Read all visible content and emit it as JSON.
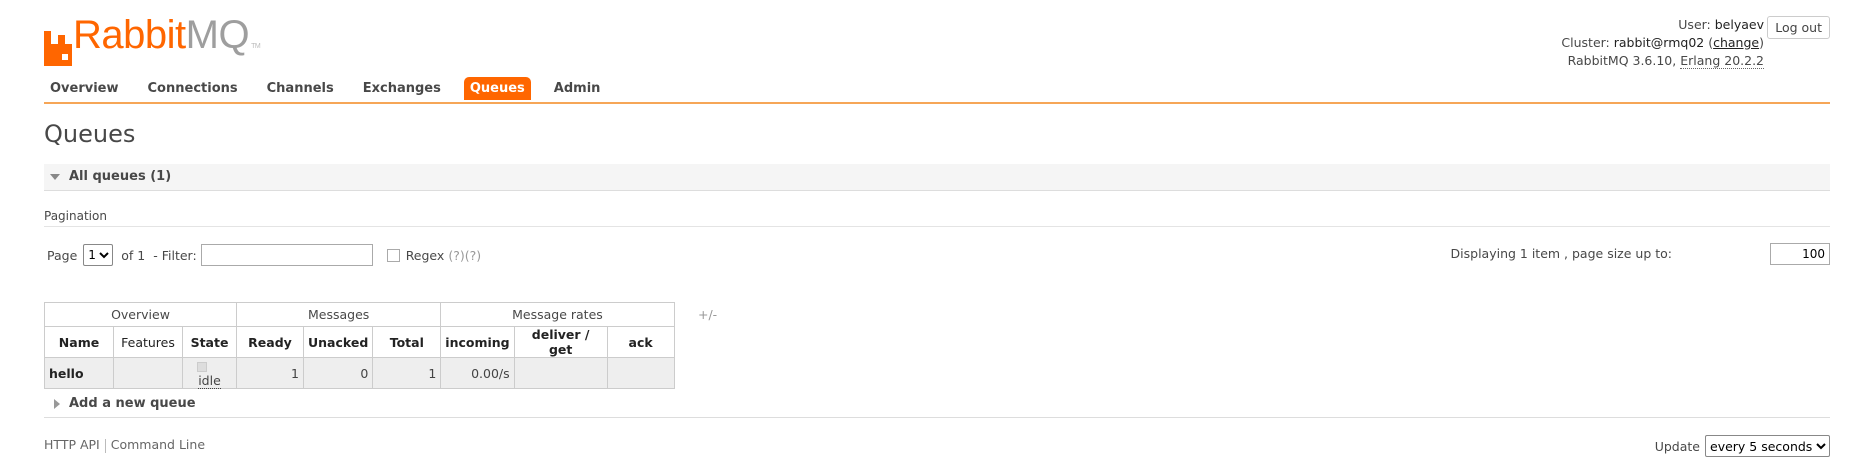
{
  "brand": {
    "rabbit": "Rabbit",
    "mq": "MQ",
    "tm": "TM"
  },
  "header": {
    "user_label": "User:",
    "user": "belyaev",
    "cluster_label": "Cluster:",
    "cluster": "rabbit@rmq02",
    "change": "change",
    "version_label": "RabbitMQ 3.6.10,",
    "erlang": "Erlang 20.2.2",
    "logout": "Log out"
  },
  "tabs": [
    {
      "label": "Overview"
    },
    {
      "label": "Connections"
    },
    {
      "label": "Channels"
    },
    {
      "label": "Exchanges"
    },
    {
      "label": "Queues",
      "active": true
    },
    {
      "label": "Admin"
    }
  ],
  "page_title": "Queues",
  "all_queues": "All queues (1)",
  "pagination": {
    "label": "Pagination",
    "page_label": "Page",
    "page_value": "1",
    "of_label": "of 1",
    "filter_label": "- Filter:",
    "filter_value": "",
    "regex_label": "Regex",
    "regex_hint": "(?)(?)",
    "display_info": "Displaying 1 item , page size up to:",
    "page_size": "100"
  },
  "table": {
    "groups": [
      "Overview",
      "Messages",
      "Message rates"
    ],
    "columns": [
      "Name",
      "Features",
      "State",
      "Ready",
      "Unacked",
      "Total",
      "incoming",
      "deliver / get",
      "ack"
    ],
    "plus_minus": "+/-",
    "rows": [
      {
        "name": "hello",
        "features": "",
        "state": "idle",
        "ready": "1",
        "unacked": "0",
        "total": "1",
        "incoming": "0.00/s",
        "deliver_get": "",
        "ack": ""
      }
    ]
  },
  "add_queue": "Add a new queue",
  "footer": {
    "http_api": "HTTP API",
    "command_line": "Command Line",
    "update_label": "Update",
    "update_value": "every 5 seconds"
  },
  "colors": {
    "accent": "#ff6600",
    "tab_line": "#f6a657"
  }
}
